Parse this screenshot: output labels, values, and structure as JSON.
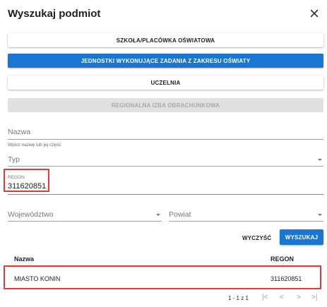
{
  "dialog": {
    "title": "Wyszukaj podmiot",
    "close_icon": "close-icon"
  },
  "categories": [
    {
      "label": "SZKOŁA/PLACÓWKA OŚWIATOWA",
      "state": "default"
    },
    {
      "label": "JEDNOSTKI WYKONUJĄCE ZADANIA Z ZAKRESU OŚWIATY",
      "state": "selected"
    },
    {
      "label": "UCZELNIA",
      "state": "default"
    },
    {
      "label": "REGIONALNA IZBA OBRACHUNKOWA",
      "state": "disabled"
    }
  ],
  "form": {
    "nazwa_label": "Nazwa",
    "nazwa_hint": "Wpisz nazwę lub jej część",
    "typ_label": "Typ",
    "regon_label": "REGON",
    "regon_value": "311620851",
    "wojewodztwo_label": "Województwo",
    "powiat_label": "Powiat"
  },
  "actions": {
    "clear_label": "WYCZYŚĆ",
    "search_label": "WYSZUKAJ"
  },
  "table": {
    "headers": {
      "nazwa": "Nazwa",
      "regon": "REGON"
    },
    "rows": [
      {
        "nazwa": "MIASTO KONIN",
        "regon": "311620851"
      }
    ]
  },
  "pagination": {
    "range": "1 - 1 z 1",
    "first_icon": "first-page-icon",
    "prev_icon": "prev-page-icon",
    "next_icon": "next-page-icon",
    "last_icon": "last-page-icon"
  },
  "colors": {
    "primary": "#1976d2",
    "highlight": "#e53935",
    "disabled_bg": "#e0e0e0"
  }
}
